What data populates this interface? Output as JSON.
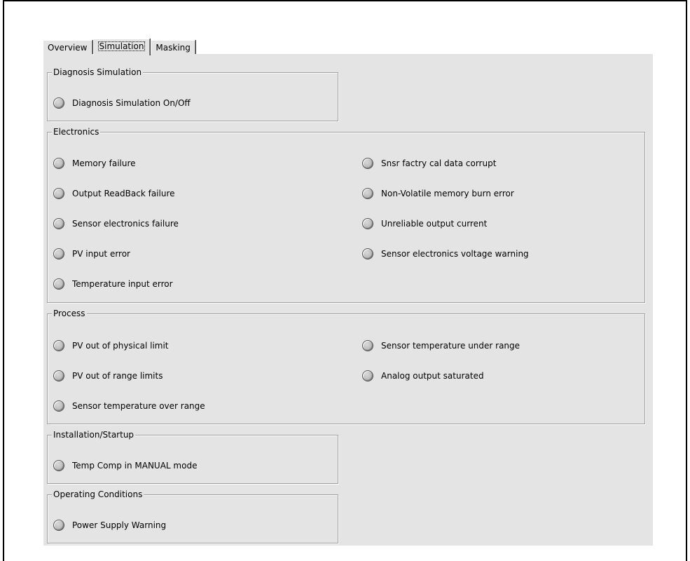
{
  "tabs": [
    {
      "label": "Overview",
      "active": false
    },
    {
      "label": "Simulation",
      "active": true
    },
    {
      "label": "Masking",
      "active": false
    }
  ],
  "groups": {
    "diagnosis_simulation": {
      "title": "Diagnosis Simulation",
      "items": [
        "Diagnosis Simulation On/Off"
      ]
    },
    "electronics": {
      "title": "Electronics",
      "left": [
        "Memory failure",
        "Output ReadBack failure",
        "Sensor electronics failure",
        "PV input error",
        "Temperature input error"
      ],
      "right": [
        "Snsr factry cal data corrupt",
        "Non-Volatile memory burn error",
        "Unreliable output current",
        "Sensor electronics voltage warning"
      ]
    },
    "process": {
      "title": "Process",
      "left": [
        "PV out of physical limit",
        "PV out of range limits",
        "Sensor temperature over range"
      ],
      "right": [
        "Sensor temperature under range",
        "Analog output saturated"
      ]
    },
    "installation_startup": {
      "title": "Installation/Startup",
      "items": [
        "Temp Comp in MANUAL mode"
      ]
    },
    "operating_conditions": {
      "title": "Operating Conditions",
      "items": [
        "Power Supply Warning"
      ]
    }
  },
  "colors": {
    "panel_bg": "#e4e4e4",
    "led_gray": "#bdbdbd",
    "group_border": "#a0a0a0"
  }
}
